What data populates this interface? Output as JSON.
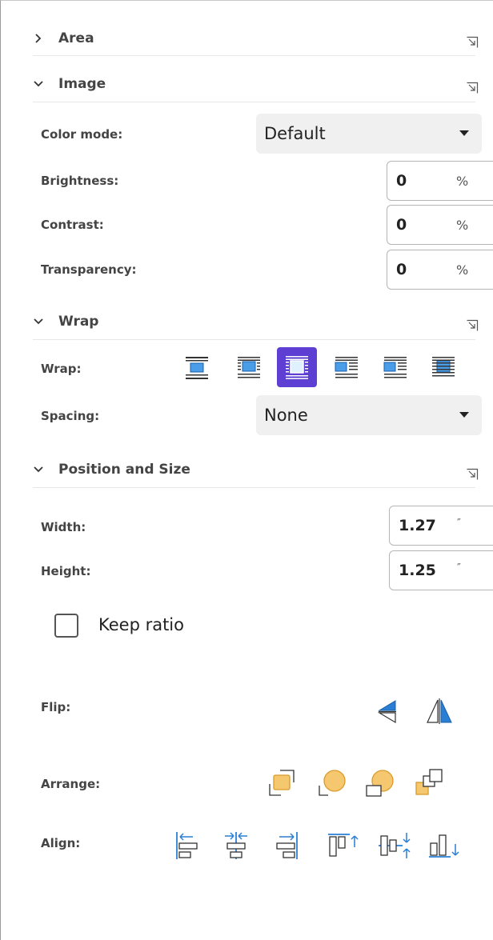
{
  "sections": {
    "area": {
      "title": "Area"
    },
    "image": {
      "title": "Image"
    },
    "wrap": {
      "title": "Wrap"
    },
    "position": {
      "title": "Position and Size"
    }
  },
  "image": {
    "color_mode_label": "Color mode:",
    "color_mode_value": "Default",
    "brightness_label": "Brightness:",
    "brightness_value": "0",
    "contrast_label": "Contrast:",
    "contrast_value": "0",
    "transparency_label": "Transparency:",
    "transparency_value": "0",
    "percent_unit": "%"
  },
  "wrap": {
    "wrap_label": "Wrap:",
    "spacing_label": "Spacing:",
    "spacing_value": "None",
    "options": [
      "wrap-none-icon",
      "wrap-parallel-icon",
      "wrap-optimal-icon",
      "wrap-left-icon",
      "wrap-right-icon",
      "wrap-through-icon"
    ],
    "selected_option": "wrap-optimal-icon"
  },
  "position": {
    "width_label": "Width:",
    "width_value": "1.27",
    "height_label": "Height:",
    "height_value": "1.25",
    "inch_unit": "″",
    "keep_ratio_label": "Keep ratio",
    "keep_ratio_checked": false,
    "flip_label": "Flip:",
    "arrange_label": "Arrange:",
    "align_label": "Align:"
  },
  "colors": {
    "accent": "#5d3fd3",
    "icon_blue": "#2a7fd4",
    "icon_orange": "#f5c870"
  }
}
